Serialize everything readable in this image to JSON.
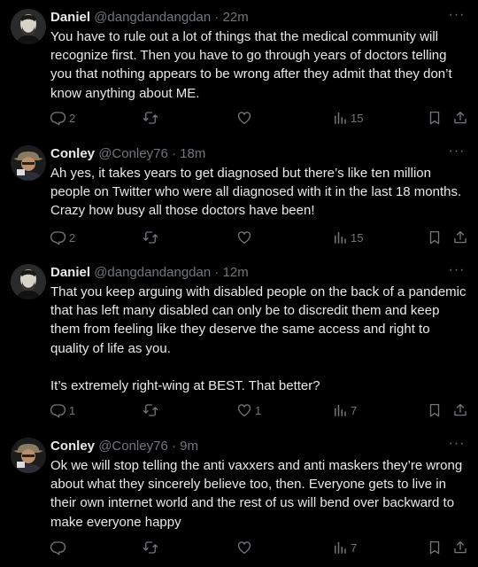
{
  "tweets": [
    {
      "name": "Daniel",
      "handle": "@dangdandangdan",
      "sep": "·",
      "time": "22m",
      "text": [
        "You have to rule out a lot of things that the medical community will recognize first. Then you have to go through years of doctors telling you that nothing appears to be wrong after they admit that they don’t know anything about ME."
      ],
      "replies": "2",
      "retweets": "",
      "likes": "",
      "views": "15"
    },
    {
      "name": "Conley",
      "handle": "@Conley76",
      "sep": "·",
      "time": "18m",
      "text": [
        "Ah yes, it takes years to get diagnosed but there’s like ten million people on Twitter who were all diagnosed with it in the last 18 months. Crazy how busy all those doctors have been!"
      ],
      "replies": "2",
      "retweets": "",
      "likes": "",
      "views": "15"
    },
    {
      "name": "Daniel",
      "handle": "@dangdandangdan",
      "sep": "·",
      "time": "12m",
      "text": [
        "That you keep arguing with disabled people on the back of a pandemic that has left many disabled can only be to discredit them and keep them from feeling like they deserve the same access and right to quality of life as you.",
        "It’s extremely right-wing at BEST. That better?"
      ],
      "replies": "1",
      "retweets": "",
      "likes": "1",
      "views": "7"
    },
    {
      "name": "Conley",
      "handle": "@Conley76",
      "sep": "·",
      "time": "9m",
      "text": [
        "Ok we will stop telling the anti vaxxers and anti maskers they’re wrong about what they sincerely believe too, then. Everyone gets to live in their own internet world and the rest of us will bend over backward to make everyone happy"
      ],
      "replies": "",
      "retweets": "",
      "likes": "",
      "views": "7"
    }
  ],
  "icons": {
    "more": "more-horizontal-icon",
    "reply": "reply-icon",
    "retweet": "retweet-icon",
    "like": "heart-icon",
    "views": "views-bar-icon",
    "bookmark": "bookmark-icon",
    "share": "share-icon"
  },
  "colors": {
    "background": "#000000",
    "text": "#e7e9ea",
    "secondary": "#71767b"
  }
}
